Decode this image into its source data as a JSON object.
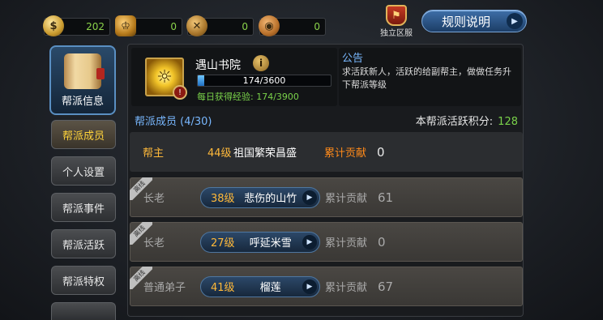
{
  "currencies": [
    {
      "icon": "gold-coin-icon",
      "value": "202"
    },
    {
      "icon": "crown-icon",
      "value": "0"
    },
    {
      "icon": "crossed-swords-icon",
      "value": "0"
    },
    {
      "icon": "bronze-coin-icon",
      "value": "0"
    }
  ],
  "header": {
    "server_label": "独立区服",
    "rules_label": "规则说明"
  },
  "sidebar": {
    "top_label": "帮派信息",
    "items": [
      {
        "label": "帮派成员"
      },
      {
        "label": "个人设置"
      },
      {
        "label": "帮派事件"
      },
      {
        "label": "帮派活跃"
      },
      {
        "label": "帮派特权"
      }
    ]
  },
  "guild": {
    "name": "遇山书院",
    "xp_text": "174/3600",
    "xp_progress": 0.048,
    "daily_xp": "每日获得经验: 174/3900"
  },
  "notice": {
    "title": "公告",
    "text": "求活跃新人，活跃的给副帮主，做做任务升下帮派等级"
  },
  "members": {
    "title": "帮派成员 (4/30)",
    "activity_label": "本帮派活跃积分:",
    "activity_value": "128",
    "leader": {
      "rank": "帮主",
      "level": "44级",
      "name": "祖国繁荣昌盛",
      "contrib_label": "累计贡献",
      "contrib": "0"
    },
    "list": [
      {
        "offline": "离线",
        "rank": "长老",
        "level": "38级",
        "name": "悲伤的山竹",
        "contrib_label": "累计贡献",
        "contrib": "61"
      },
      {
        "offline": "离线",
        "rank": "长老",
        "level": "27级",
        "name": "呼延米雪",
        "contrib_label": "累计贡献",
        "contrib": "0"
      },
      {
        "offline": "离线",
        "rank": "普通弟子",
        "level": "41级",
        "name": "榴莲",
        "contrib_label": "累计贡献",
        "contrib": "67"
      }
    ]
  },
  "colors": {
    "accent_blue": "#79b8ff",
    "green_value": "#7ad24a",
    "orange": "#ffb93a"
  }
}
